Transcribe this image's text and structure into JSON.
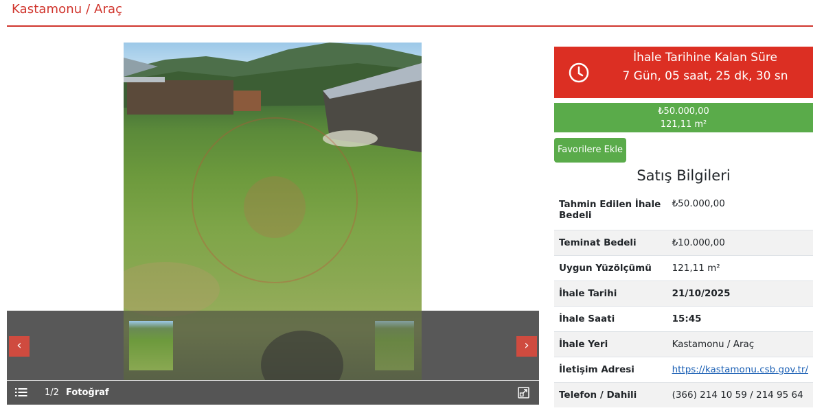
{
  "page": {
    "title": "Kastamonu / Araç"
  },
  "gallery": {
    "counter": "1/2",
    "media_label": "Fotoğraf",
    "prev_label": "‹",
    "next_label": "›"
  },
  "countdown": {
    "title": "İhale Tarihine Kalan Süre",
    "remaining": "7 Gün, 05 saat, 25 dk, 30 sn"
  },
  "price": {
    "amount": "₺50.000,00",
    "area": "121,11 m²"
  },
  "favorite_button": "Favorilere Ekle",
  "sale_info": {
    "title": "Satış Bilgileri",
    "rows": [
      {
        "label": "Tahmin Edilen İhale Bedeli",
        "value": "₺50.000,00"
      },
      {
        "label": "Teminat Bedeli",
        "value": "₺10.000,00"
      },
      {
        "label": "Uygun Yüzölçümü",
        "value": "121,11 m²"
      },
      {
        "label": "İhale Tarihi",
        "value": "21/10/2025"
      },
      {
        "label": "İhale Saati",
        "value": "15:45"
      },
      {
        "label": "İhale Yeri",
        "value": "Kastamonu / Araç"
      },
      {
        "label": "İletişim Adresi",
        "value": "https://kastamonu.csb.gov.tr/"
      },
      {
        "label": "Telefon / Dahili",
        "value": "(366) 214 10 59 / 214 95 64"
      }
    ]
  },
  "colors": {
    "accent_red": "#d0342c",
    "countdown_red": "#dc2f23",
    "green": "#5aab4a",
    "link": "#1a5fb4"
  }
}
